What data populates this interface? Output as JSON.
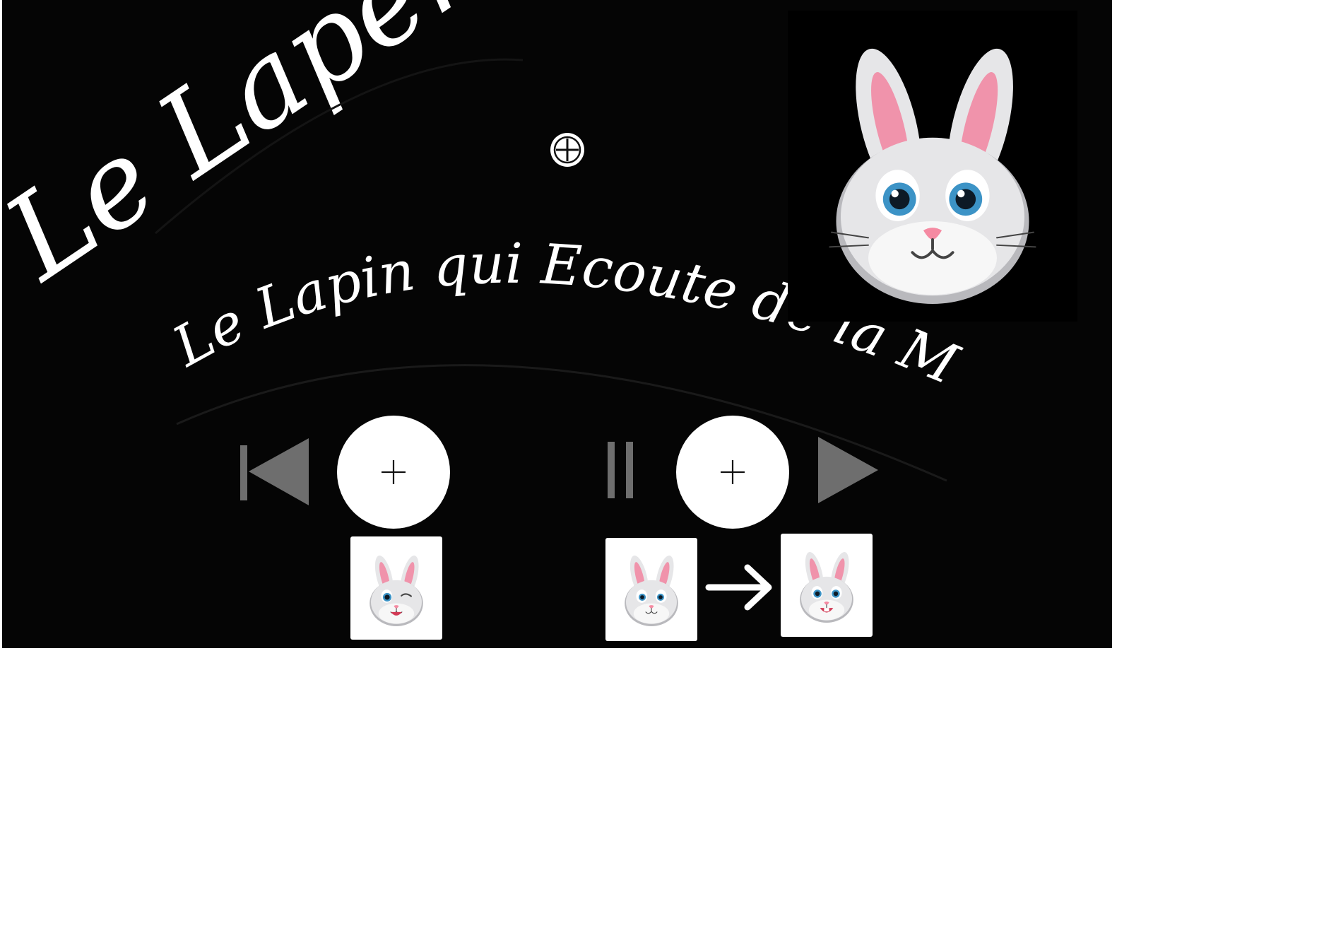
{
  "title": "Le Lapem",
  "subtitle": "Le Lapin qui Ecoute de la Musique",
  "mascot": {
    "icon": "bunny-face-icon"
  },
  "controls": {
    "previous_icon": "skip-previous-icon",
    "pause_icon": "pause-icon",
    "play_icon": "play-icon",
    "add_icon": "plus-icon"
  },
  "expressions": [
    {
      "icon": "bunny-wink-icon",
      "mood": "wink"
    },
    {
      "icon": "bunny-surprised-icon",
      "mood": "surprised"
    },
    {
      "icon": "bunny-smile-icon",
      "mood": "smile"
    }
  ],
  "arrow_icon": "right-arrow-icon",
  "colors": {
    "background": "#050505",
    "page": "#ffffff",
    "text": "#ffffff",
    "control_gray": "#6e6e6e",
    "ear_pink": "#f093ab",
    "iris_blue": "#3c93c6"
  }
}
